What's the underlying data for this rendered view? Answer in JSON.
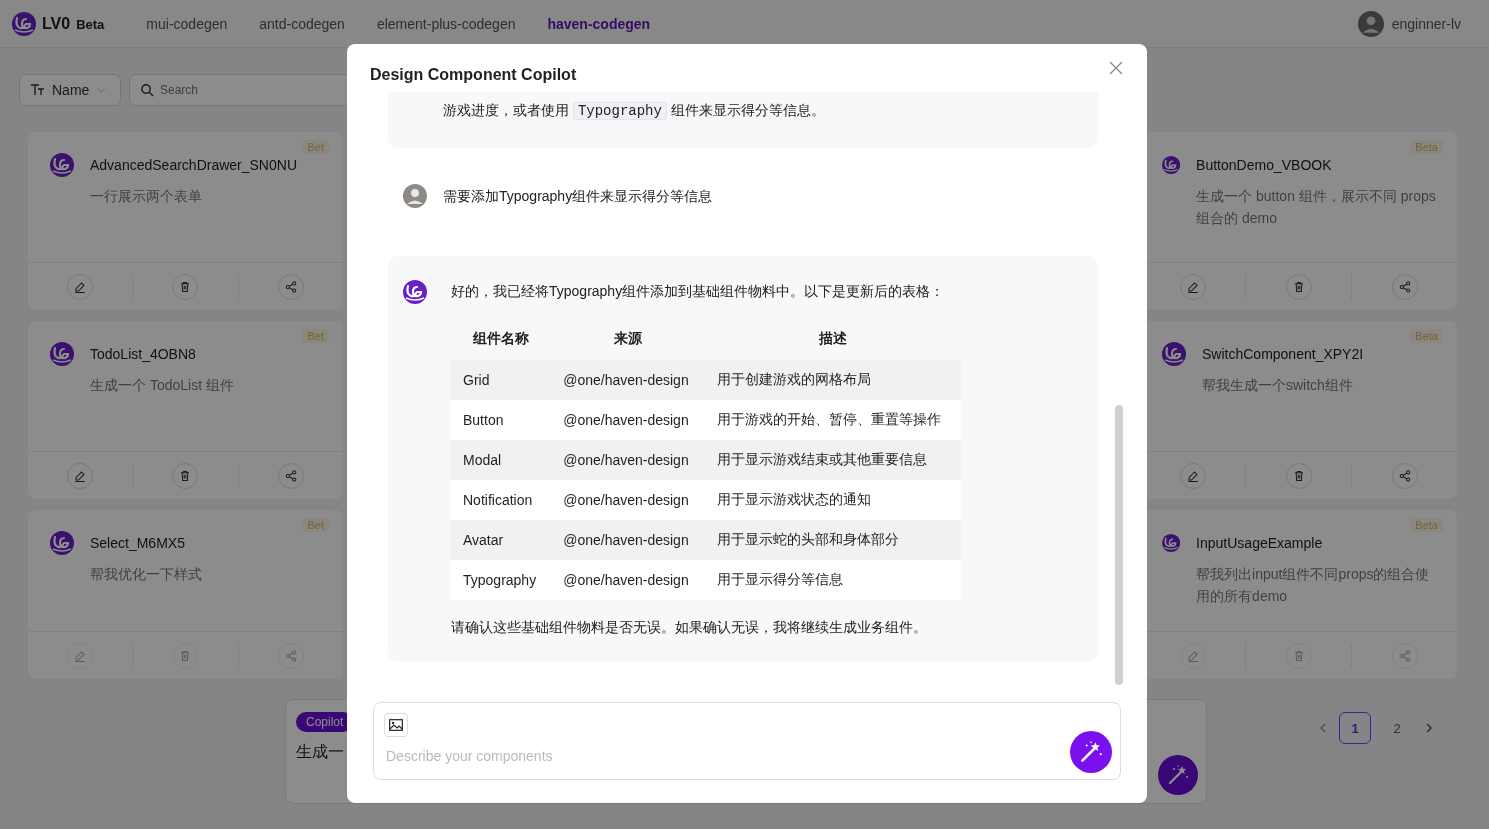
{
  "topbar": {
    "brand": "LV0",
    "brand_tag": "Beta",
    "nav": [
      {
        "label": "mui-codegen",
        "selected": false
      },
      {
        "label": "antd-codegen",
        "selected": false
      },
      {
        "label": "element-plus-codegen",
        "selected": false
      },
      {
        "label": "haven-codegen",
        "selected": true
      }
    ],
    "user": "enginner-lv"
  },
  "toolbar": {
    "sort": "Name",
    "search": {
      "placeholder": "Search"
    }
  },
  "cards_left": [
    {
      "title": "AdvancedSearchDrawer_SN0NU",
      "description": "一行展示两个表单",
      "badge": "Bet",
      "disabled": false
    },
    {
      "title": "TodoList_4OBN8",
      "description": "生成一个 TodoList 组件",
      "badge": "Bet",
      "disabled": false
    },
    {
      "title": "Select_M6MX5",
      "description": "帮我优化一下样式",
      "badge": "Bet",
      "disabled": true
    }
  ],
  "cards_right": [
    {
      "title": "ButtonDemo_VBOOK",
      "description": "生成一个 button 组件，展示不同 props 组合的 demo",
      "badge": "Beta",
      "disabled": false
    },
    {
      "title": "SwitchComponent_XPY2I",
      "description": "帮我生成一个switch组件",
      "badge": "Beta",
      "disabled": false
    },
    {
      "title": "InputUsageExample",
      "description": "帮我列出input组件不同props的组合使用的所有demo",
      "badge": "Beta",
      "disabled": true
    }
  ],
  "copilot_box": {
    "tag": "Copilot",
    "text": "生成一"
  },
  "pagination": [
    {
      "label": "1",
      "selected": true
    },
    {
      "label": "2",
      "selected": false
    }
  ],
  "modal": {
    "title": "Design Component Copilot",
    "messages": [
      {
        "kind": "continuation",
        "parts": [
          {
            "text": "游戏进度，或者使用 ",
            "kind": "text"
          },
          {
            "text": "Typography",
            "kind": "code"
          },
          {
            "text": " 组件来显示得分等信息。",
            "kind": "text"
          }
        ]
      },
      {
        "kind": "user",
        "text": "需要添加Typography组件来显示得分等信息"
      },
      {
        "kind": "assistant",
        "parts": [
          {
            "text": "好的，我已经将Typography组件添加到基础组件物料中。以下是更新后的表格：",
            "kind": "text"
          }
        ],
        "table": {
          "columns": [
            "组件名称",
            "来源",
            "描述"
          ],
          "rows": [
            [
              "Grid",
              "@one/haven-design",
              "用于创建游戏的网格布局"
            ],
            [
              "Button",
              "@one/haven-design",
              "用于游戏的开始、暂停、重置等操作"
            ],
            [
              "Modal",
              "@one/haven-design",
              "用于显示游戏结束或其他重要信息"
            ],
            [
              "Notification",
              "@one/haven-design",
              "用于显示游戏状态的通知"
            ],
            [
              "Avatar",
              "@one/haven-design",
              "用于显示蛇的头部和身体部分"
            ],
            [
              "Typography",
              "@one/haven-design",
              "用于显示得分等信息"
            ]
          ]
        },
        "footer": "请确认这些基础组件物料是否无误。如果确认无误，我将继续生成业务组件。"
      }
    ],
    "input": {
      "placeholder": "Describe your components"
    }
  }
}
